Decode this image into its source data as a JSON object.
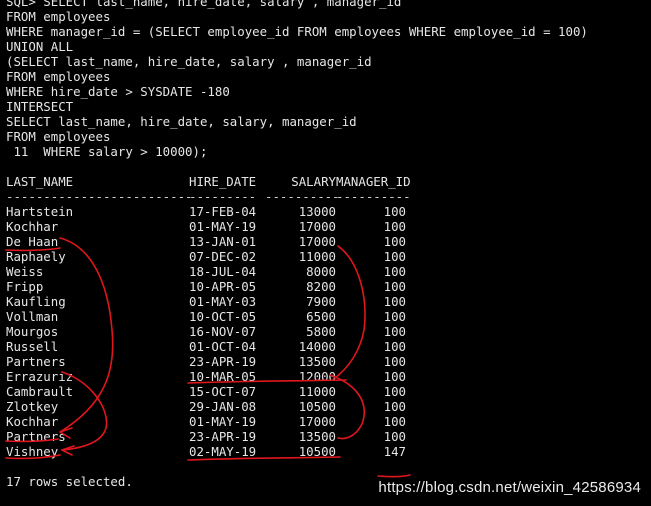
{
  "terminal": {
    "sql_lines": [
      "SQL> SELECT last_name, hire_date, salary , manager_id",
      "FROM employees",
      "WHERE manager_id = (SELECT employee_id FROM employees WHERE employee_id = 100)",
      "UNION ALL",
      "(SELECT last_name, hire_date, salary , manager_id",
      "FROM employees",
      "WHERE hire_date > SYSDATE -180",
      "INTERSECT",
      "SELECT last_name, hire_date, salary, manager_id",
      "FROM employees",
      " 11  WHERE salary > 10000);"
    ],
    "table": {
      "columns": [
        "LAST_NAME",
        "HIRE_DATE",
        "SALARY",
        "MANAGER_ID"
      ],
      "separators": [
        "-------------------------",
        "---------",
        "----------",
        "----------"
      ],
      "rows": [
        [
          "Hartstein",
          "17-FEB-04",
          "13000",
          "100"
        ],
        [
          "Kochhar",
          "01-MAY-19",
          "17000",
          "100"
        ],
        [
          "De Haan",
          "13-JAN-01",
          "17000",
          "100"
        ],
        [
          "Raphaely",
          "07-DEC-02",
          "11000",
          "100"
        ],
        [
          "Weiss",
          "18-JUL-04",
          "8000",
          "100"
        ],
        [
          "Fripp",
          "10-APR-05",
          "8200",
          "100"
        ],
        [
          "Kaufling",
          "01-MAY-03",
          "7900",
          "100"
        ],
        [
          "Vollman",
          "10-OCT-05",
          "6500",
          "100"
        ],
        [
          "Mourgos",
          "16-NOV-07",
          "5800",
          "100"
        ],
        [
          "Russell",
          "01-OCT-04",
          "14000",
          "100"
        ],
        [
          "Partners",
          "23-APR-19",
          "13500",
          "100"
        ],
        [
          "Errazuriz",
          "10-MAR-05",
          "12000",
          "100"
        ],
        [
          "Cambrault",
          "15-OCT-07",
          "11000",
          "100"
        ],
        [
          "Zlotkey",
          "29-JAN-08",
          "10500",
          "100"
        ],
        [
          "Kochhar",
          "01-MAY-19",
          "17000",
          "100"
        ],
        [
          "Partners",
          "23-APR-19",
          "13500",
          "100"
        ],
        [
          "Vishney",
          "02-MAY-19",
          "10500",
          "147"
        ]
      ]
    },
    "footer": "17 rows selected."
  },
  "watermark": "https://blog.csdn.net/weixin_42586934",
  "colors": {
    "background": "#000000",
    "text": "#e6e6e6",
    "annotation": "#e0161c",
    "watermark": "#ffffff"
  }
}
